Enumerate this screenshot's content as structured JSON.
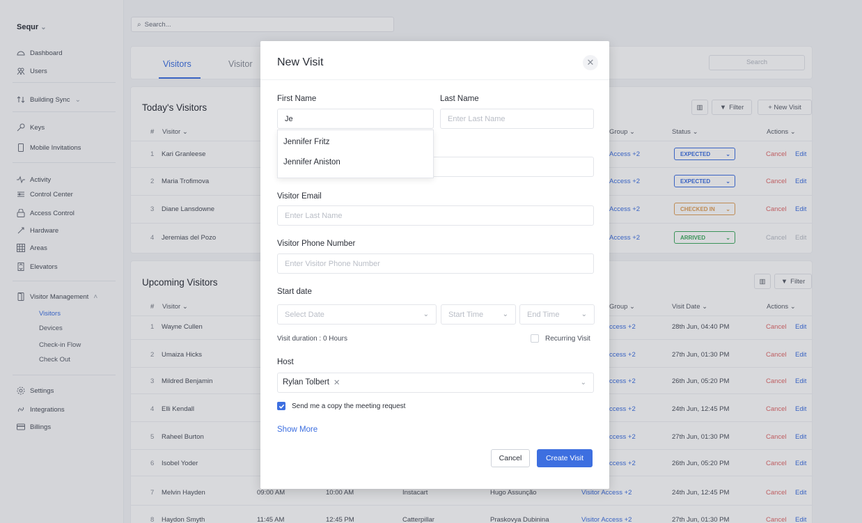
{
  "sidebar": {
    "brand": "Sequr",
    "items": [
      {
        "label": "Dashboard",
        "icon": "dashboard-icon"
      },
      {
        "label": "Users",
        "icon": "users-icon"
      },
      {
        "label": "Building Sync",
        "icon": "sync-icon"
      },
      {
        "label": "Keys",
        "icon": "key-icon"
      },
      {
        "label": "Mobile Invitations",
        "icon": "mobile-icon"
      },
      {
        "label": "Activity",
        "icon": "activity-icon"
      },
      {
        "label": "Control Center",
        "icon": "control-icon"
      },
      {
        "label": "Access Control",
        "icon": "lock-icon"
      },
      {
        "label": "Hardware",
        "icon": "hardware-icon"
      },
      {
        "label": "Areas",
        "icon": "areas-icon"
      },
      {
        "label": "Elevators",
        "icon": "elevator-icon"
      },
      {
        "label": "Visitor Management",
        "icon": "visitor-icon"
      },
      {
        "label": "Settings",
        "icon": "gear-icon"
      },
      {
        "label": "Integrations",
        "icon": "link-icon"
      },
      {
        "label": "Billings",
        "icon": "card-icon"
      }
    ],
    "sub_items": [
      "Visitors",
      "Devices",
      "Check-in Flow",
      "Check Out"
    ]
  },
  "main": {
    "search_placeholder": "Search...",
    "tabs": [
      "Visitors",
      "Visitor"
    ],
    "tabs_search": "Search",
    "today": {
      "title": "Today's Visitors",
      "filter": "Filter",
      "new_visit": "+ New Visit",
      "headers": [
        "#",
        "Visitor",
        "Group",
        "Status",
        "Actions"
      ],
      "rows": [
        {
          "num": "1",
          "visitor": "Kari Granleese",
          "access": "Access +2",
          "status": "EXPECTED",
          "cancel": "Cancel",
          "edit": "Edit"
        },
        {
          "num": "2",
          "visitor": "Maria Trofimova",
          "access": "Access +2",
          "status": "EXPECTED",
          "cancel": "Cancel",
          "edit": "Edit"
        },
        {
          "num": "3",
          "visitor": "Diane Lansdowne",
          "access": "Access +2",
          "status": "CHECKED IN",
          "cancel": "Cancel",
          "edit": "Edit"
        },
        {
          "num": "4",
          "visitor": "Jeremias del Pozo",
          "access": "Access +2",
          "status": "ARRIVED",
          "cancel": "Cancel",
          "edit": "Edit"
        }
      ]
    },
    "upcoming": {
      "title": "Upcoming Visitors",
      "filter": "Filter",
      "headers": [
        "#",
        "Visitor",
        "Group",
        "Visit Date",
        "Actions"
      ],
      "rows": [
        {
          "num": "1",
          "visitor": "Wayne Cullen",
          "access": "ccess +2",
          "date": "28th Jun, 04:40 PM",
          "cancel": "Cancel",
          "edit": "Edit"
        },
        {
          "num": "2",
          "visitor": "Umaiza Hicks",
          "access": "ccess +2",
          "date": "27th Jun, 01:30 PM",
          "cancel": "Cancel",
          "edit": "Edit"
        },
        {
          "num": "3",
          "visitor": "Mildred Benjamin",
          "access": "ccess +2",
          "date": "26th Jun, 05:20 PM",
          "cancel": "Cancel",
          "edit": "Edit"
        },
        {
          "num": "4",
          "visitor": "Elli Kendall",
          "access": "ccess +2",
          "date": "24th Jun, 12:45 PM",
          "cancel": "Cancel",
          "edit": "Edit"
        },
        {
          "num": "5",
          "visitor": "Raheel Burton",
          "access": "ccess +2",
          "date": "27th Jun, 01:30 PM",
          "cancel": "Cancel",
          "edit": "Edit"
        },
        {
          "num": "6",
          "visitor": "Isobel Yoder",
          "access": "ccess +2",
          "date": "26th Jun, 05:20 PM",
          "cancel": "Cancel",
          "edit": "Edit"
        },
        {
          "num": "7",
          "visitor": "Melvin Hayden",
          "start": "09:00 AM",
          "end": "10:00 AM",
          "company": "Instacart",
          "host": "Hugo Assunção",
          "access": "Visitor Access +2",
          "date": "24th Jun, 12:45 PM",
          "cancel": "Cancel",
          "edit": "Edit"
        },
        {
          "num": "8",
          "visitor": "Haydon Smyth",
          "start": "11:45 AM",
          "end": "12:45 PM",
          "company": "Catterpillar",
          "host": "Praskovya Dubinina",
          "access": "Visitor Access +2",
          "date": "27th Jun, 01:30 PM",
          "cancel": "Cancel",
          "edit": "Edit"
        }
      ]
    }
  },
  "modal": {
    "title": "New Visit",
    "first_name_label": "First Name",
    "first_name_value": "Je",
    "last_name_label": "Last Name",
    "last_name_placeholder": "Enter Last Name",
    "suggestions": [
      "Jennifer Fritz",
      "Jennifer Aniston"
    ],
    "email_label": "Visitor Email",
    "email_placeholder": "Enter Last Name",
    "phone_label": "Visitor Phone Number",
    "phone_placeholder": "Enter Visitor Phone Number",
    "start_date_label": "Start date",
    "select_date": "Select Date",
    "start_time": "Start Time",
    "end_time": "End Time",
    "duration": "Visit duration : 0 Hours",
    "recurring": "Recurring Visit",
    "host_label": "Host",
    "host_value": "Rylan Tolbert",
    "send_copy": "Send me a copy the meeting request",
    "show_more": "Show More",
    "cancel": "Cancel",
    "create": "Create Visit"
  }
}
